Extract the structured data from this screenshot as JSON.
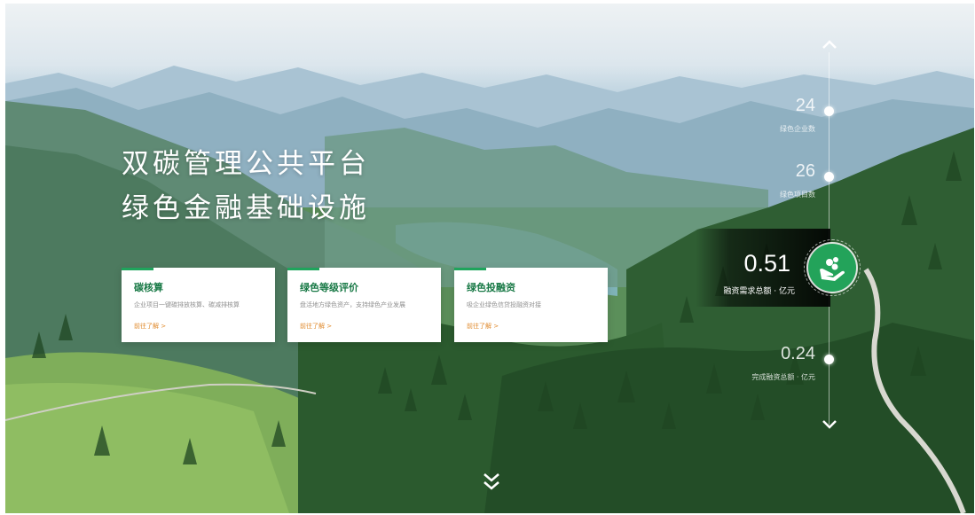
{
  "hero": {
    "title_line1": "双碳管理公共平台",
    "title_line2": "绿色金融基础设施"
  },
  "cards": [
    {
      "title": "碳核算",
      "desc": "企业项目一键碳排放核算、碳减排核算",
      "link": "前往了解 >"
    },
    {
      "title": "绿色等级评价",
      "desc": "盘活地方绿色资产，支持绿色产业发展",
      "link": "前往了解 >"
    },
    {
      "title": "绿色投融资",
      "desc": "吸企业绿色信贷投融资对接",
      "link": "前往了解 >"
    }
  ],
  "timeline": {
    "up_icon": "chevron-up-icon",
    "down_icon": "arrow-down-icon",
    "items": [
      {
        "value": "24",
        "label": "绿色企业数"
      },
      {
        "value": "26",
        "label": "绿色项目数"
      },
      {
        "value": "0.51",
        "label": "融资需求总额 · 亿元",
        "active": true,
        "icon": "money-hand-icon"
      },
      {
        "value": "0.24",
        "label": "完成融资总额 · 亿元"
      }
    ]
  },
  "scroll_down_icon": "double-chevron-down-icon",
  "colors": {
    "accent_green": "#1fa45c",
    "title_green": "#1a7a47",
    "link_orange": "#e08a2c",
    "active_circle": "#23a35a"
  }
}
